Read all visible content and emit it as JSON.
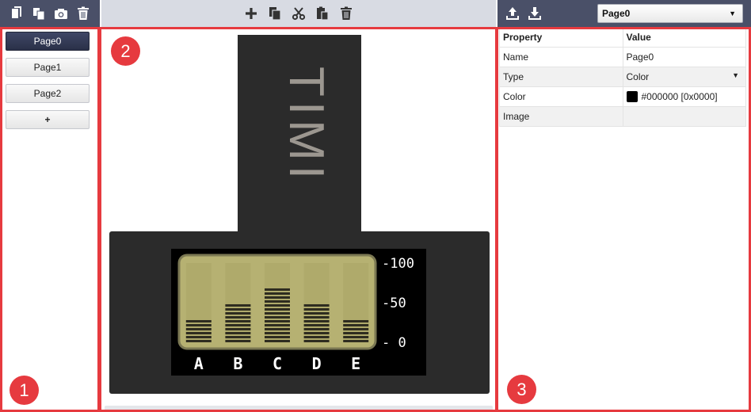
{
  "toolbar_left": {
    "icons": [
      "add-page-icon",
      "copy-page-icon",
      "screenshot-icon",
      "delete-page-icon"
    ]
  },
  "toolbar_center": {
    "icons": [
      "add-element-icon",
      "copy-element-icon",
      "cut-element-icon",
      "paste-element-icon",
      "delete-element-icon"
    ]
  },
  "toolbar_right": {
    "icons": [
      "upload-icon",
      "download-icon"
    ],
    "page_select_value": "Page0"
  },
  "pages": {
    "items": [
      "Page0",
      "Page1",
      "Page2"
    ],
    "active": "Page0",
    "add_label": "+"
  },
  "device": {
    "brand_text": "TIMI",
    "y_ticks": [
      "-100",
      "-50",
      "- 0"
    ],
    "categories": [
      "A",
      "B",
      "C",
      "D",
      "E"
    ],
    "values": [
      30,
      50,
      70,
      50,
      30
    ],
    "ylim": [
      0,
      100
    ],
    "lcd_color": "#b6b172",
    "bar_color": "#2e2c20",
    "body_color": "#2b2b2b"
  },
  "properties": {
    "header_property": "Property",
    "header_value": "Value",
    "rows": [
      {
        "property": "Name",
        "value": "Page0"
      },
      {
        "property": "Type",
        "value": "Color"
      },
      {
        "property": "Color",
        "value": "#000000 [0x0000]"
      },
      {
        "property": "Image",
        "value": ""
      }
    ],
    "color_swatch": "#000000"
  },
  "annotations": {
    "badge1": "1",
    "badge2": "2",
    "badge3": "3",
    "frame_color": "#e63a3f"
  }
}
